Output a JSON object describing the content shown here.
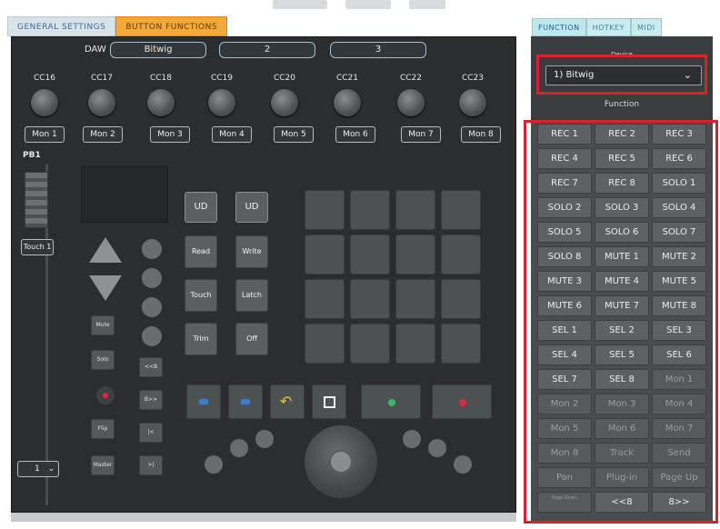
{
  "top_tabs": [
    {
      "label": "GENERAL SETTINGS",
      "active": false
    },
    {
      "label": "BUTTON FUNCTIONS",
      "active": true
    }
  ],
  "daw": {
    "label": "DAW",
    "fields": [
      "Bitwig",
      "2",
      "3"
    ]
  },
  "knobs": [
    "CC16",
    "CC17",
    "CC18",
    "CC19",
    "CC20",
    "CC21",
    "CC22",
    "CC23"
  ],
  "mon_buttons": [
    "Mon 1",
    "Mon 2",
    "Mon 3",
    "Mon 4",
    "Mon 5",
    "Mon 6",
    "Mon 7",
    "Mon 8"
  ],
  "fader": {
    "label": "PB1",
    "touch": "Touch 1"
  },
  "bank": {
    "value": "1"
  },
  "mid_buttons": {
    "ud1": "UD",
    "ud2": "UD",
    "read": "Read",
    "write": "Write",
    "touch": "Touch",
    "latch": "Latch",
    "trim": "Trim",
    "off": "Off"
  },
  "small_buttons": {
    "mute": "Mute",
    "solo": "Solo",
    "flip": "Flip",
    "master": "Master",
    "ff": "<<B",
    "rew": "B>>",
    "prev": "|<",
    "next": ">|"
  },
  "right_tabs": [
    {
      "label": "FUNCTION",
      "active": true
    },
    {
      "label": "HOTKEY",
      "active": false
    },
    {
      "label": "MIDI",
      "active": false
    }
  ],
  "device": {
    "label": "Device",
    "value": "1) Bitwig"
  },
  "function_label": "Function",
  "function_buttons": [
    {
      "label": "REC 1"
    },
    {
      "label": "REC 2"
    },
    {
      "label": "REC 3"
    },
    {
      "label": "REC 4"
    },
    {
      "label": "REC 5"
    },
    {
      "label": "REC 6"
    },
    {
      "label": "REC 7"
    },
    {
      "label": "REC 8"
    },
    {
      "label": "SOLO 1"
    },
    {
      "label": "SOLO 2"
    },
    {
      "label": "SOLO 3"
    },
    {
      "label": "SOLO 4"
    },
    {
      "label": "SOLO 5"
    },
    {
      "label": "SOLO 6"
    },
    {
      "label": "SOLO 7"
    },
    {
      "label": "SOLO 8"
    },
    {
      "label": "MUTE 1"
    },
    {
      "label": "MUTE 2"
    },
    {
      "label": "MUTE 3"
    },
    {
      "label": "MUTE 4"
    },
    {
      "label": "MUTE 5"
    },
    {
      "label": "MUTE 6"
    },
    {
      "label": "MUTE 7"
    },
    {
      "label": "MUTE 8"
    },
    {
      "label": "SEL 1"
    },
    {
      "label": "SEL 2"
    },
    {
      "label": "SEL 3"
    },
    {
      "label": "SEL 4"
    },
    {
      "label": "SEL 5"
    },
    {
      "label": "SEL 6"
    },
    {
      "label": "SEL 7"
    },
    {
      "label": "SEL 8"
    },
    {
      "label": "Mon 1",
      "dim": true
    },
    {
      "label": "Mon 2",
      "dim": true
    },
    {
      "label": "Mon 3",
      "dim": true
    },
    {
      "label": "Mon 4",
      "dim": true
    },
    {
      "label": "Mon 5",
      "dim": true
    },
    {
      "label": "Mon 6",
      "dim": true
    },
    {
      "label": "Mon 7",
      "dim": true
    },
    {
      "label": "Mon 8",
      "dim": true
    },
    {
      "label": "Track",
      "dim": true
    },
    {
      "label": "Send",
      "dim": true
    },
    {
      "label": "Pan",
      "dim": true
    },
    {
      "label": "Plug-in",
      "dim": true
    },
    {
      "label": "Page Up",
      "dim": true
    },
    {
      "label": "Page Down",
      "dim": true,
      "tiny": true
    },
    {
      "label": "<<8"
    },
    {
      "label": "8>>"
    }
  ],
  "colors": {
    "accent_tab": "#f2a93b",
    "highlight": "#d8232f",
    "panel": "#2b2d2f",
    "transport_blue": "#3b7fd0",
    "transport_yellow": "#e4c53a",
    "transport_green": "#3fb56a",
    "transport_red": "#e0283a"
  }
}
